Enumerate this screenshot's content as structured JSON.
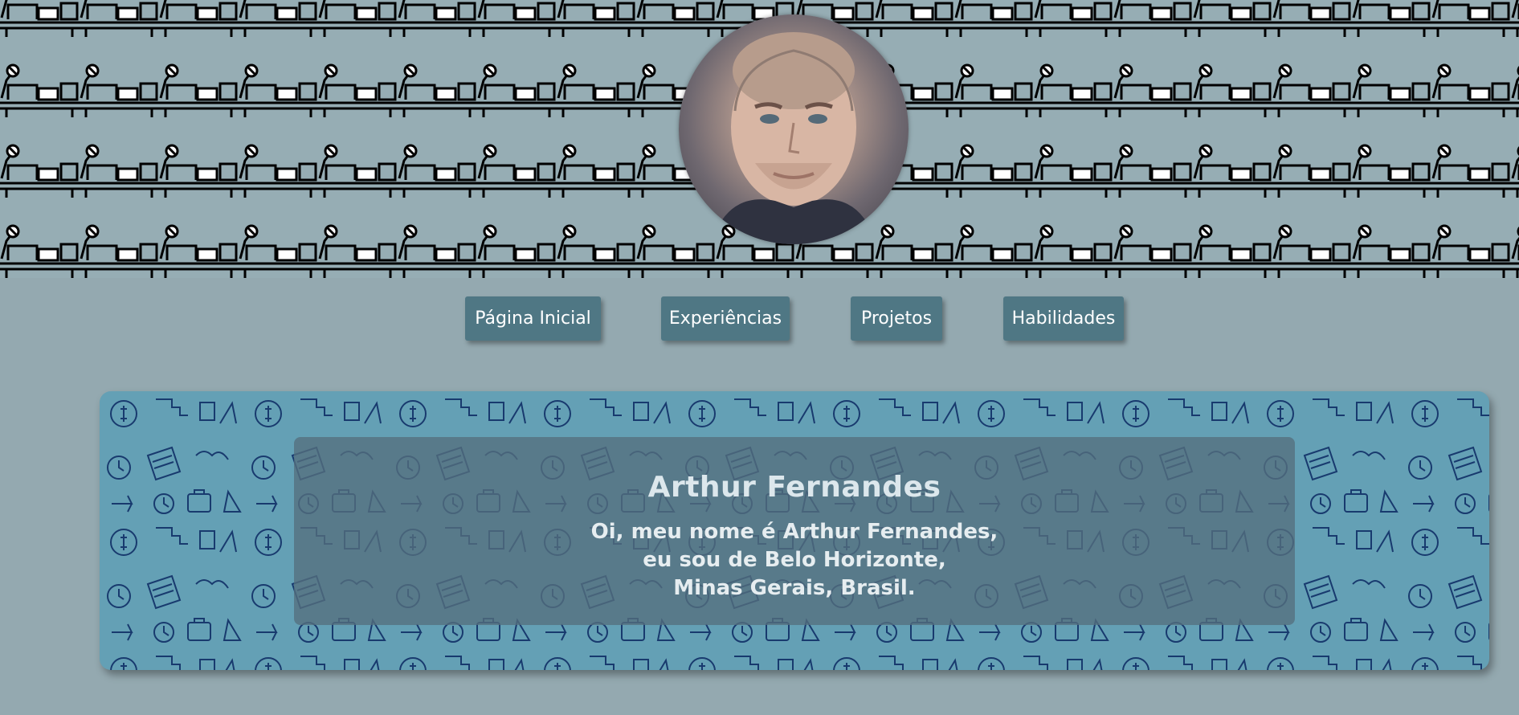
{
  "header": {
    "avatar_alt": "Arthur Fernandes"
  },
  "nav": {
    "items": [
      {
        "label": "Página Inicial"
      },
      {
        "label": "Experiências"
      },
      {
        "label": "Projetos"
      },
      {
        "label": "Habilidades"
      }
    ]
  },
  "intro": {
    "name": "Arthur Fernandes",
    "lines": [
      "Oi, meu nome é Arthur Fernandes,",
      "eu sou de Belo Horizonte,",
      "Minas Gerais, Brasil."
    ]
  },
  "colors": {
    "page_bg": "#94a9b0",
    "nav_button": "#4f7784",
    "card_bg": "#64a0b5",
    "card_overlay": "#54707d"
  }
}
